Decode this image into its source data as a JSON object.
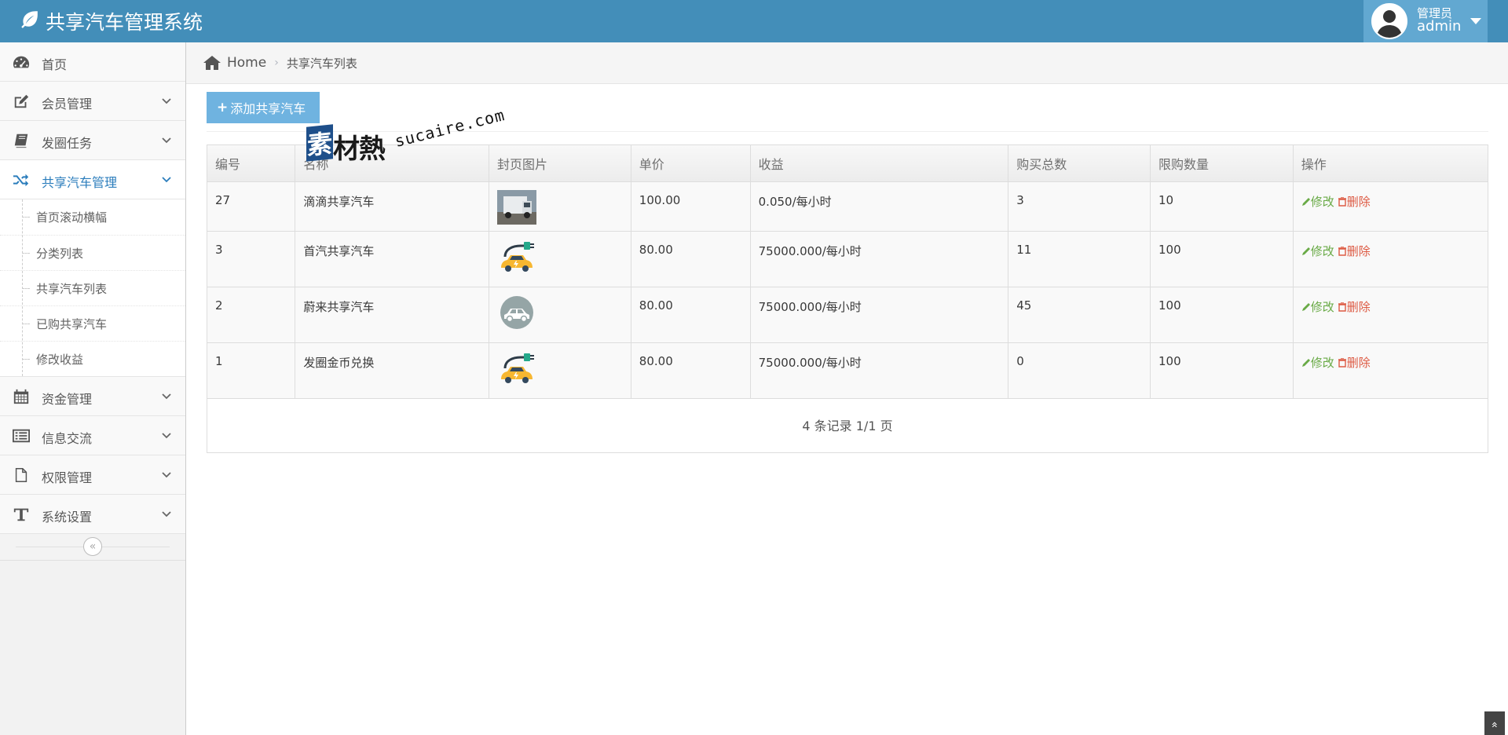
{
  "app": {
    "title": "共享汽车管理系统"
  },
  "user": {
    "role": "管理员",
    "name": "admin"
  },
  "sidebar": {
    "items": [
      {
        "label": "首页",
        "icon": "dashboard-icon",
        "expandable": false
      },
      {
        "label": "会员管理",
        "icon": "edit-icon",
        "expandable": true
      },
      {
        "label": "发圈任务",
        "icon": "book-icon",
        "expandable": true
      },
      {
        "label": "共享汽车管理",
        "icon": "shuffle-icon",
        "expandable": true,
        "active": true
      },
      {
        "label": "资金管理",
        "icon": "calendar-icon",
        "expandable": true
      },
      {
        "label": "信息交流",
        "icon": "list-icon",
        "expandable": true
      },
      {
        "label": "权限管理",
        "icon": "file-icon",
        "expandable": true
      },
      {
        "label": "系统设置",
        "icon": "text-icon",
        "expandable": true
      }
    ],
    "submenu": [
      {
        "label": "首页滚动横幅"
      },
      {
        "label": "分类列表"
      },
      {
        "label": "共享汽车列表"
      },
      {
        "label": "已购共享汽车"
      },
      {
        "label": "修改收益"
      }
    ],
    "toggle_glyph": "«"
  },
  "breadcrumb": {
    "home": "Home",
    "separator": "›",
    "current": "共享汽车列表"
  },
  "toolbar": {
    "add_label": "添加共享汽车",
    "add_glyph": "+"
  },
  "table": {
    "headers": [
      "编号",
      "名称",
      "封页图片",
      "单价",
      "收益",
      "购买总数",
      "限购数量",
      "操作"
    ],
    "rows": [
      {
        "id": "27",
        "name": "滴滴共享汽车",
        "image": "truck-photo",
        "price": "100.00",
        "income": "0.050/每小时",
        "total": "3",
        "limit": "10"
      },
      {
        "id": "3",
        "name": "首汽共享汽车",
        "image": "electric-car-icon",
        "price": "80.00",
        "income": "75000.000/每小时",
        "total": "11",
        "limit": "100"
      },
      {
        "id": "2",
        "name": "蔚来共享汽车",
        "image": "car-circle-icon",
        "price": "80.00",
        "income": "75000.000/每小时",
        "total": "45",
        "limit": "100"
      },
      {
        "id": "1",
        "name": "发圈金币兑换",
        "image": "electric-car-icon",
        "price": "80.00",
        "income": "75000.000/每小时",
        "total": "0",
        "limit": "100"
      }
    ],
    "edit_label": "修改",
    "delete_label": "删除",
    "pager": "4 条记录 1/1 页"
  },
  "watermark": {
    "logo_char": "素",
    "cn": "材熱",
    "en": "sucaire.com"
  },
  "scroll_top_glyph": "»",
  "colors": {
    "navbar": "#438eb9",
    "user_box": "#62a8d1",
    "add_button": "#6fb3e0",
    "active_menu": "#2b7dbc",
    "edit": "#69aa46",
    "delete": "#dd5a43"
  }
}
